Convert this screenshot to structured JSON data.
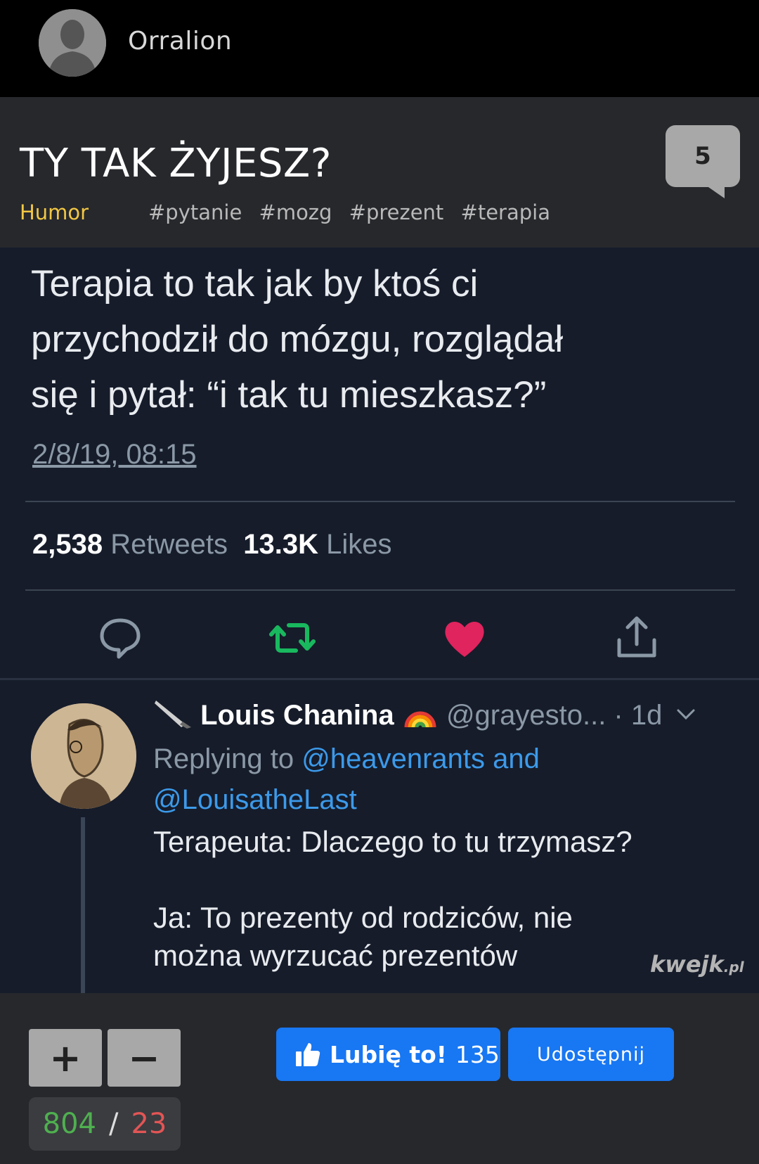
{
  "header": {
    "username": "Orralion"
  },
  "post": {
    "title": "TY TAK ŻYJESZ?",
    "comment_count": "5",
    "category": "Humor",
    "tags": [
      "#pytanie",
      "#mozg",
      "#prezent",
      "#terapia"
    ]
  },
  "tweet": {
    "text": "Terapia to tak jak by ktoś ci\nprzychodził do mózgu, rozglądał\nsię i pytał: “i tak tu mieszkasz?”",
    "date": "2/8/19, 08:15",
    "retweets_count": "2,538",
    "retweets_label": "Retweets",
    "likes_count": "13.3K",
    "likes_label": "Likes"
  },
  "reply": {
    "name": "Louis Chanina",
    "handle_time": "@grayesto... · 1d",
    "replying_prefix": "Replying to",
    "mention1": "@heavenrants and",
    "mention2": "@LouisatheLast",
    "line1": "Terapeuta: Dlaczego to tu trzymasz?",
    "line2": "Ja: To prezenty od rodziców, nie\nmożna wyrzucać prezentów"
  },
  "watermark": {
    "main": "kwejk",
    "suffix": ".pl"
  },
  "voting": {
    "plus_label": "+",
    "minus_label": "−",
    "up_votes": "804",
    "separator": "/",
    "down_votes": "23"
  },
  "facebook": {
    "like_label": "Lubię to!",
    "like_count": "135",
    "share_label": "Udostępnij"
  },
  "colors": {
    "category": "#f2c744",
    "retweet_icon": "#19b85e",
    "like_icon": "#e0245e",
    "mention": "#3c9aea",
    "facebook": "#1877f2",
    "up_votes": "#4fb04f",
    "down_votes": "#e25555"
  }
}
